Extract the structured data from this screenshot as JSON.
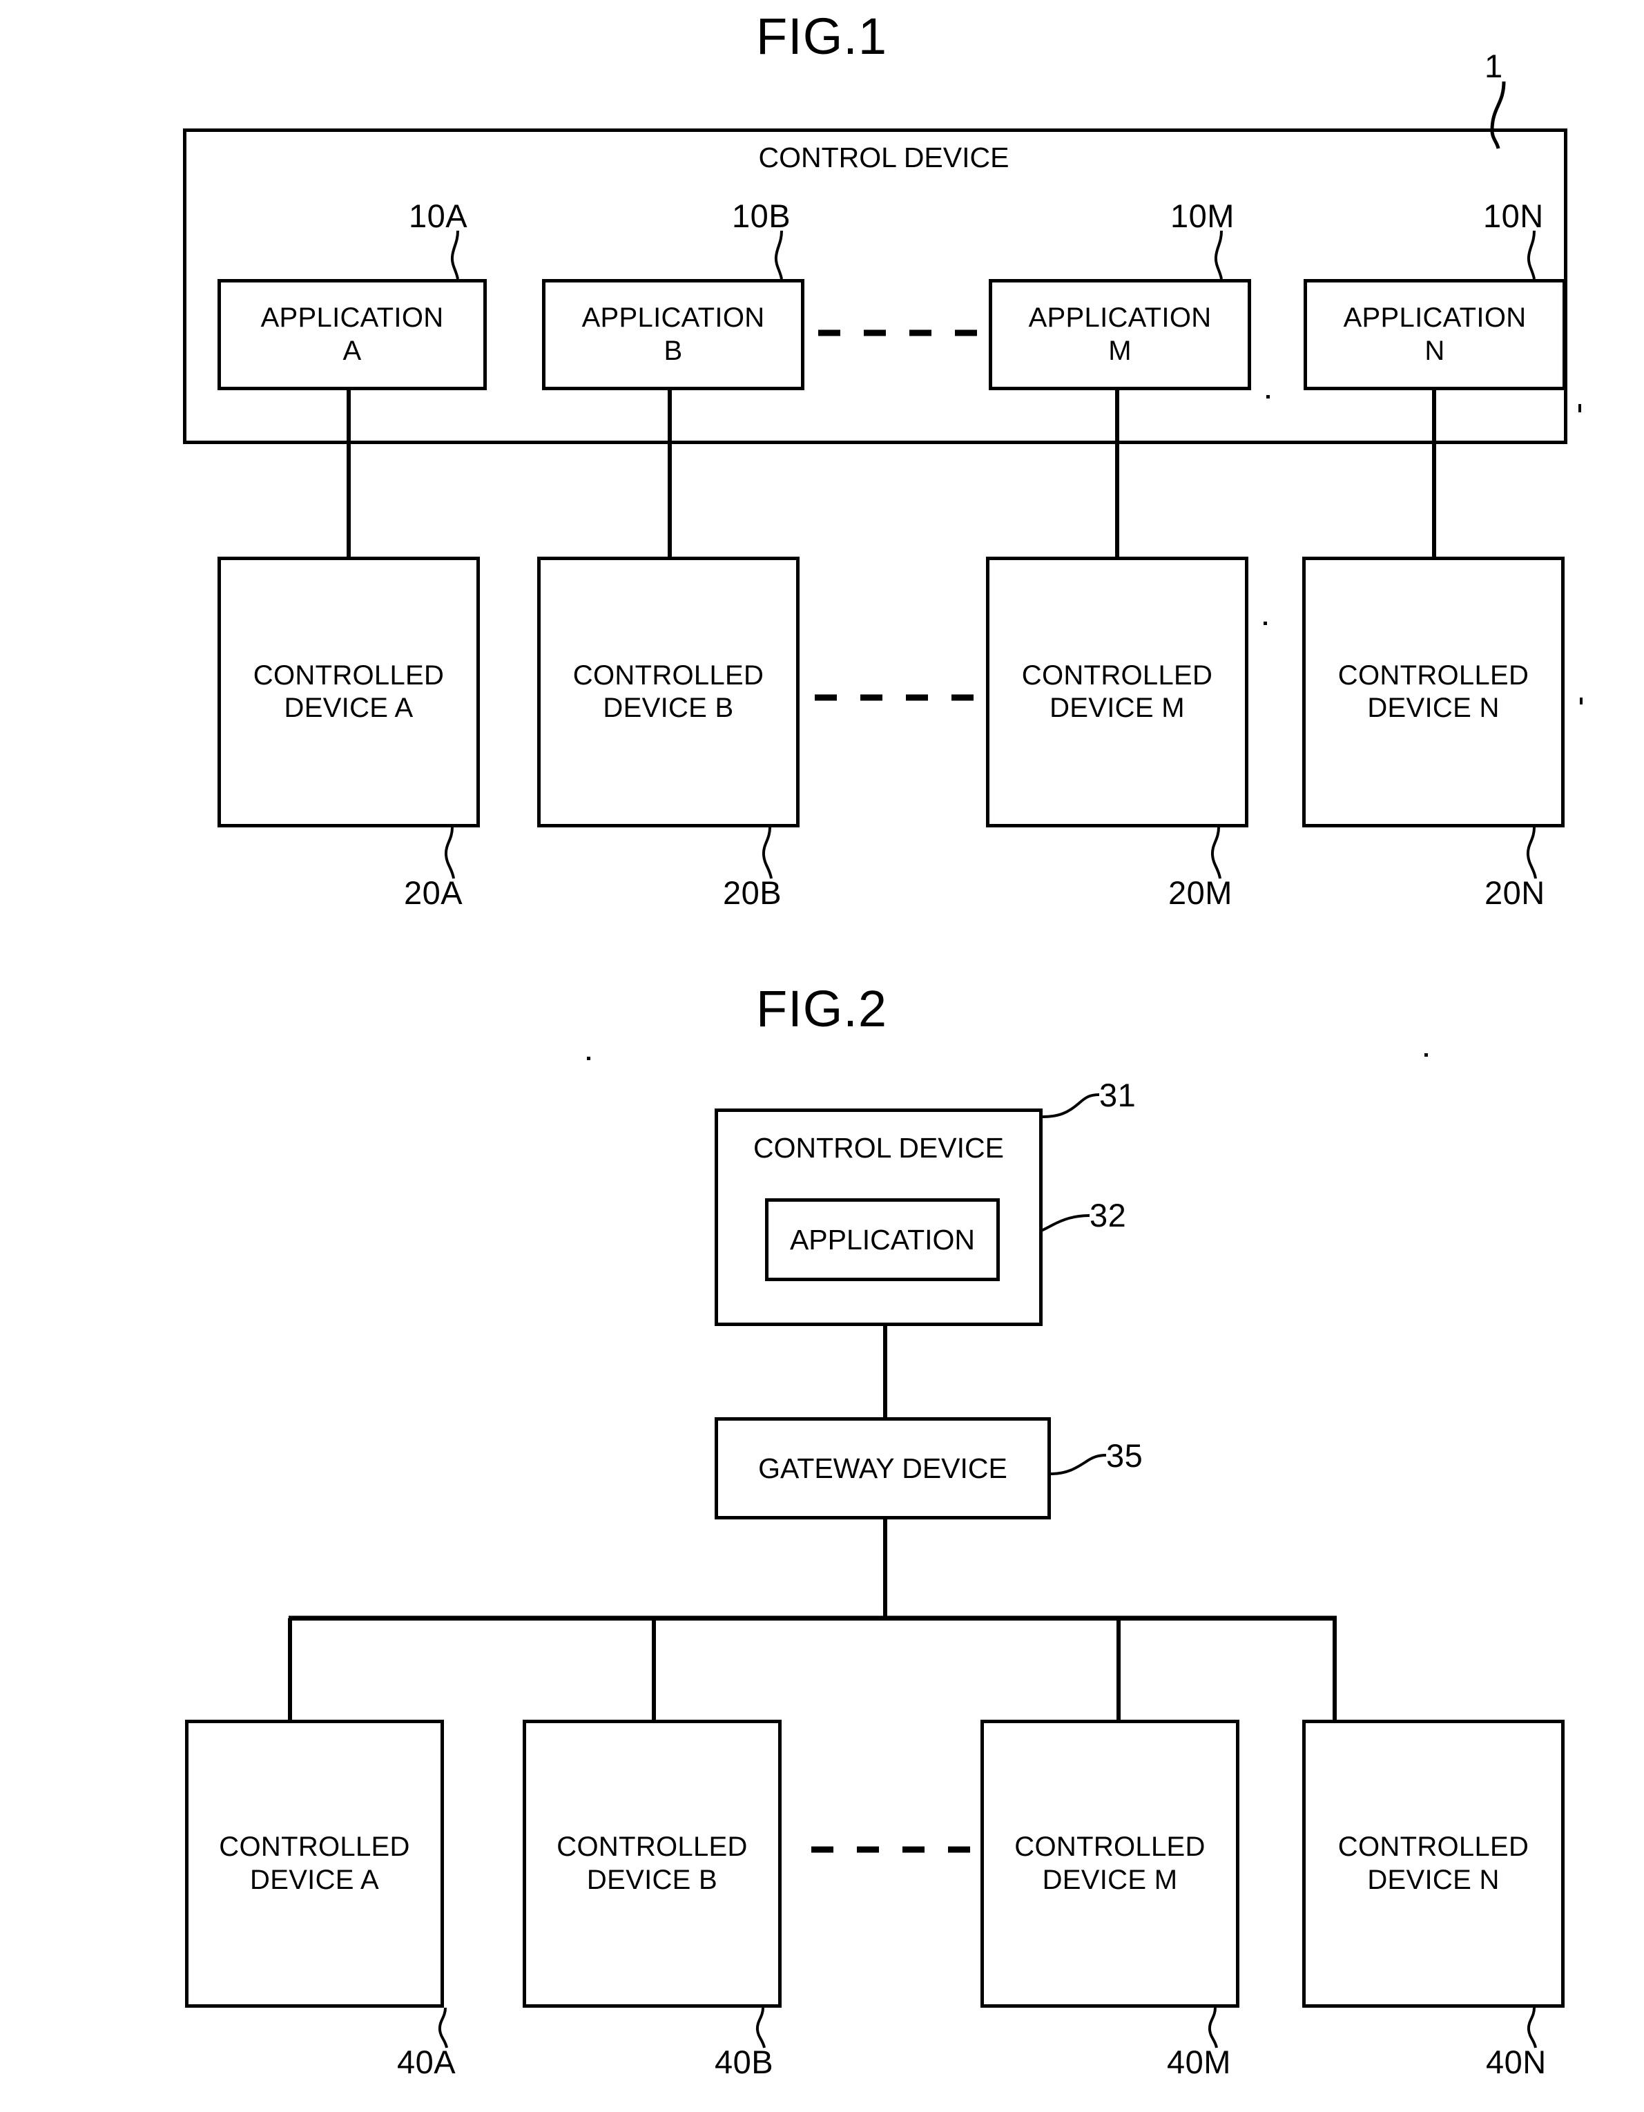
{
  "figures": [
    {
      "title": "FIG.1",
      "outer": {
        "header": "CONTROL DEVICE",
        "ref": "1"
      },
      "applications": [
        {
          "label": "APPLICATION\nA",
          "ref": "10A"
        },
        {
          "label": "APPLICATION\nB",
          "ref": "10B"
        },
        {
          "label": "APPLICATION\nM",
          "ref": "10M"
        },
        {
          "label": "APPLICATION\nN",
          "ref": "10N"
        }
      ],
      "controlled_devices": [
        {
          "label": "CONTROLLED\nDEVICE A",
          "ref": "20A"
        },
        {
          "label": "CONTROLLED\nDEVICE B",
          "ref": "20B"
        },
        {
          "label": "CONTROLLED\nDEVICE M",
          "ref": "20M"
        },
        {
          "label": "CONTROLLED\nDEVICE N",
          "ref": "20N"
        }
      ]
    },
    {
      "title": "FIG.2",
      "control_device": {
        "label": "CONTROL DEVICE",
        "ref": "31",
        "application": {
          "label": "APPLICATION",
          "ref": "32"
        }
      },
      "gateway": {
        "label": "GATEWAY DEVICE",
        "ref": "35"
      },
      "controlled_devices": [
        {
          "label": "CONTROLLED\nDEVICE A",
          "ref": "40A"
        },
        {
          "label": "CONTROLLED\nDEVICE B",
          "ref": "40B"
        },
        {
          "label": "CONTROLLED\nDEVICE M",
          "ref": "40M"
        },
        {
          "label": "CONTROLLED\nDEVICE N",
          "ref": "40N"
        }
      ]
    }
  ],
  "colors": {
    "ink": "#000000",
    "paper": "#ffffff"
  }
}
